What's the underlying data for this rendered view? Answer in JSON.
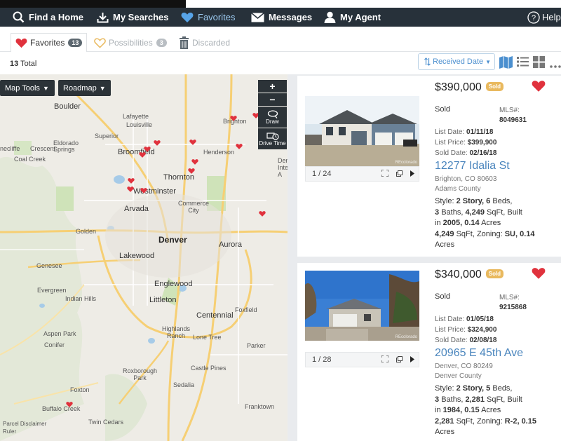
{
  "nav": {
    "find_home": "Find a Home",
    "my_searches": "My Searches",
    "favorites": "Favorites",
    "messages": "Messages",
    "my_agent": "My Agent",
    "help": "Help"
  },
  "tabs": {
    "favorites_label": "Favorites",
    "favorites_count": "13",
    "possibilities_label": "Possibilities",
    "possibilities_count": "3",
    "discarded_label": "Discarded"
  },
  "toolbar": {
    "total_count": "13",
    "total_label": "Total",
    "sort_label": "Received Date"
  },
  "map": {
    "map_tools": "Map Tools",
    "roadmap": "Roadmap",
    "zoom_in": "+",
    "zoom_out": "−",
    "draw": "Draw",
    "drive_time": "Drive Time",
    "disclaimer": "Parcel Disclaimer",
    "ruler": "Ruler",
    "places": {
      "boulder": "Boulder",
      "lafayette": "Lafayette",
      "louisville": "Louisville",
      "superior": "Superior",
      "broomfield": "Broomfield",
      "brighton": "Brighton",
      "thornton": "Thornton",
      "westminster": "Westminster",
      "arvada": "Arvada",
      "commerce_city": "Commerce\nCity",
      "denver": "Denver",
      "aurora": "Aurora",
      "lakewood": "Lakewood",
      "golden": "Golden",
      "genesee": "Genesee",
      "evergreen": "Evergreen",
      "indian_hills": "Indian Hills",
      "englewood": "Englewood",
      "littleton": "Littleton",
      "centennial": "Centennial",
      "foxfield": "Foxfield",
      "highlands_ranch": "Highlands\nRanch",
      "lone_tree": "Lone Tree",
      "parker": "Parker",
      "aspen_park": "Aspen Park",
      "conifer": "Conifer",
      "roxborough_park": "Roxborough\nPark",
      "castle_pines": "Castle Pines",
      "sedalia": "Sedalia",
      "foxton": "Foxton",
      "franktown": "Franktown",
      "buffalo_creek": "Buffalo Creek",
      "twin_cedars": "Twin Cedars",
      "henderson": "Henderson",
      "eldorado_springs": "Eldorado\nSprings",
      "crescent": "Crescent",
      "nederland": "necliffe",
      "coal_creek": "Coal Creek",
      "denver_intl": "Den\nInter\nA"
    }
  },
  "listings": [
    {
      "price": "$390,000",
      "badge": "Sold",
      "status": "Sold",
      "mls_label": "MLS#:",
      "mls_number": "8049631",
      "list_date_label": "List Date:",
      "list_date": "01/11/18",
      "list_price_label": "List Price:",
      "list_price": "$399,900",
      "sold_date_label": "Sold Date:",
      "sold_date": "02/16/18",
      "street": "12277 Idalia St",
      "city_line": "Brighton, CO 80603",
      "county": "Adams County",
      "photo_counter": "1 / 24",
      "watermark": "REcolorado",
      "specs": {
        "style_label": "Style:",
        "style": "2 Story,",
        "beds": "6",
        "beds_label": "Beds,",
        "baths": "3",
        "baths_label": "Baths,",
        "sqft": "4,249",
        "sqft_label": "SqFt,",
        "built_label": "Built",
        "in_label": "in",
        "year": "2005,",
        "acres": "0.14",
        "acres_label": "Acres",
        "sqft2": "4,249",
        "sqft2_label": "SqFt,",
        "zoning_label": "Zoning:",
        "zoning": "SU,",
        "acres2": "0.14",
        "acres2_label": "Acres"
      }
    },
    {
      "price": "$340,000",
      "badge": "Sold",
      "status": "Sold",
      "mls_label": "MLS#:",
      "mls_number": "9215868",
      "list_date_label": "List Date:",
      "list_date": "01/05/18",
      "list_price_label": "List Price:",
      "list_price": "$324,900",
      "sold_date_label": "Sold Date:",
      "sold_date": "02/08/18",
      "street": "20965 E 45th Ave",
      "city_line": "Denver, CO 80249",
      "county": "Denver County",
      "photo_counter": "1 / 28",
      "watermark": "REcolorado",
      "specs": {
        "style_label": "Style:",
        "style": "2 Story,",
        "beds": "5",
        "beds_label": "Beds,",
        "baths": "3",
        "baths_label": "Baths,",
        "sqft": "2,281",
        "sqft_label": "SqFt,",
        "built_label": "Built",
        "in_label": "in",
        "year": "1984,",
        "acres": "0.15",
        "acres_label": "Acres",
        "sqft2": "2,281",
        "sqft2_label": "SqFt,",
        "zoning_label": "Zoning:",
        "zoning": "R-2,",
        "acres2": "0.15",
        "acres2_label": "Acres"
      }
    }
  ],
  "colors": {
    "nav_bg": "#27313a",
    "accent_blue": "#4a85bd",
    "heart_red": "#e0323d",
    "sold_badge": "#e9b95e"
  }
}
